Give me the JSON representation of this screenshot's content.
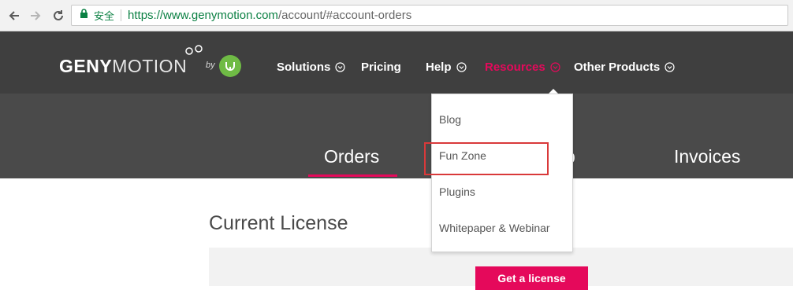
{
  "browser": {
    "secure_label": "安全",
    "url_scheme_host": "https://www.genymotion.com",
    "url_path": "/account/#account-orders",
    "back_icon": "back-arrow-icon",
    "forward_icon": "forward-arrow-icon",
    "reload_icon": "reload-icon",
    "lock_icon": "lock-icon"
  },
  "header": {
    "logo_bold": "GENY",
    "logo_light": "MOTION",
    "logo_by": "by",
    "nav": [
      {
        "label": "Solutions",
        "has_chevron": true,
        "active": false
      },
      {
        "label": "Pricing",
        "has_chevron": false,
        "active": false
      },
      {
        "label": "Help",
        "has_chevron": true,
        "active": false
      },
      {
        "label": "Resources",
        "has_chevron": true,
        "active": true
      },
      {
        "label": "Other Products",
        "has_chevron": true,
        "active": false
      }
    ]
  },
  "tabs": [
    {
      "label": "Orders",
      "active": true
    },
    {
      "label": "p",
      "active": false
    },
    {
      "label": "Invoices",
      "active": false
    }
  ],
  "dropdown": {
    "items": [
      "Blog",
      "Fun Zone",
      "Plugins",
      "Whitepaper & Webinar"
    ],
    "highlighted": "Fun Zone"
  },
  "main": {
    "section_title": "Current License",
    "get_license_label": "Get a license"
  },
  "colors": {
    "accent": "#e5095b",
    "header_bg": "#3f3f3f",
    "subheader_bg": "#4a4a4a",
    "highlight_border": "#d9393a",
    "logo_badge": "#6fbb45"
  }
}
